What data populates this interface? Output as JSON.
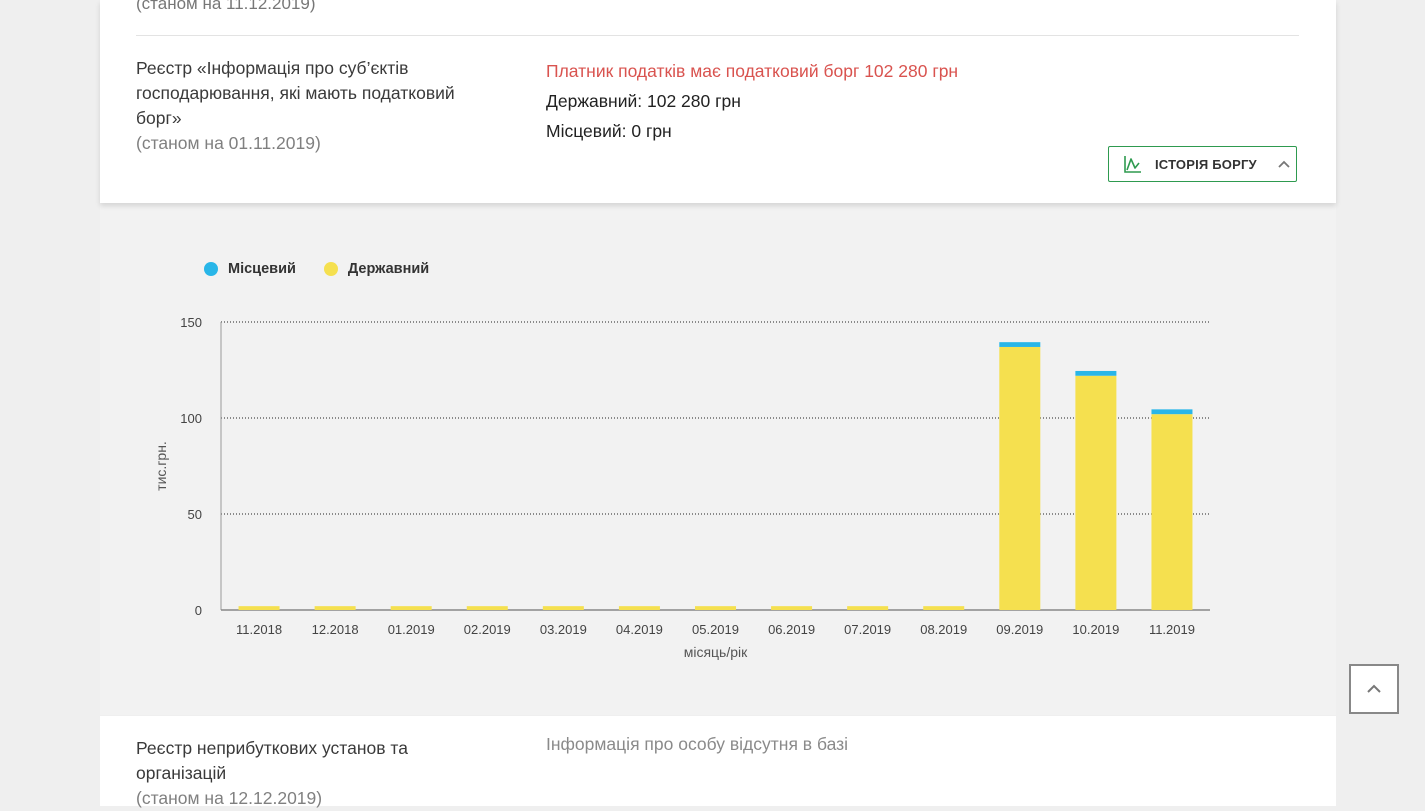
{
  "previous_row": {
    "date_text": "(станом на 11.12.2019)"
  },
  "tax_debt_register": {
    "title": "Реєстр «Інформація про суб’єктів господарювання, які мають податковий борг»",
    "date_text": "(станом на 01.11.2019)",
    "alert": "Платник податків має податковий борг 102 280 грн",
    "state_line": "Державний: 102 280 грн",
    "local_line": "Місцевий: 0 грн",
    "history_button_label": "ІСТОРІЯ БОРГУ"
  },
  "non_profit_register": {
    "title": "Реєстр неприбуткових установ та організацій",
    "date_text": "(станом на 12.12.2019)",
    "info": "Інформація про особу відсутня в базі"
  },
  "colors": {
    "alert": "#d9534f",
    "accent_green": "#2e9a4f",
    "local_series": "#29b6e8",
    "state_series": "#f5e04f"
  },
  "icons": {
    "history_button": "line-chart-icon",
    "history_toggle": "chevron-up-icon",
    "scroll_top": "chevron-up-icon"
  },
  "chart_data": {
    "type": "bar",
    "stacked": true,
    "title": "",
    "xlabel": "місяць/рік",
    "ylabel": "тис.грн.",
    "ylim": [
      0,
      150
    ],
    "yticks": [
      0,
      50,
      100,
      150
    ],
    "grid": true,
    "legend_position": "top-left",
    "categories": [
      "11.2018",
      "12.2018",
      "01.2019",
      "02.2019",
      "03.2019",
      "04.2019",
      "05.2019",
      "06.2019",
      "07.2019",
      "08.2019",
      "09.2019",
      "10.2019",
      "11.2019"
    ],
    "series": [
      {
        "name": "Державний",
        "values": [
          2,
          2,
          2,
          2,
          2,
          2,
          2,
          2,
          2,
          2,
          137,
          122,
          102
        ]
      },
      {
        "name": "Місцевий",
        "values": [
          0,
          0,
          0,
          0,
          0,
          0,
          0,
          0,
          0,
          0,
          2.5,
          2.5,
          2.5
        ]
      }
    ]
  }
}
